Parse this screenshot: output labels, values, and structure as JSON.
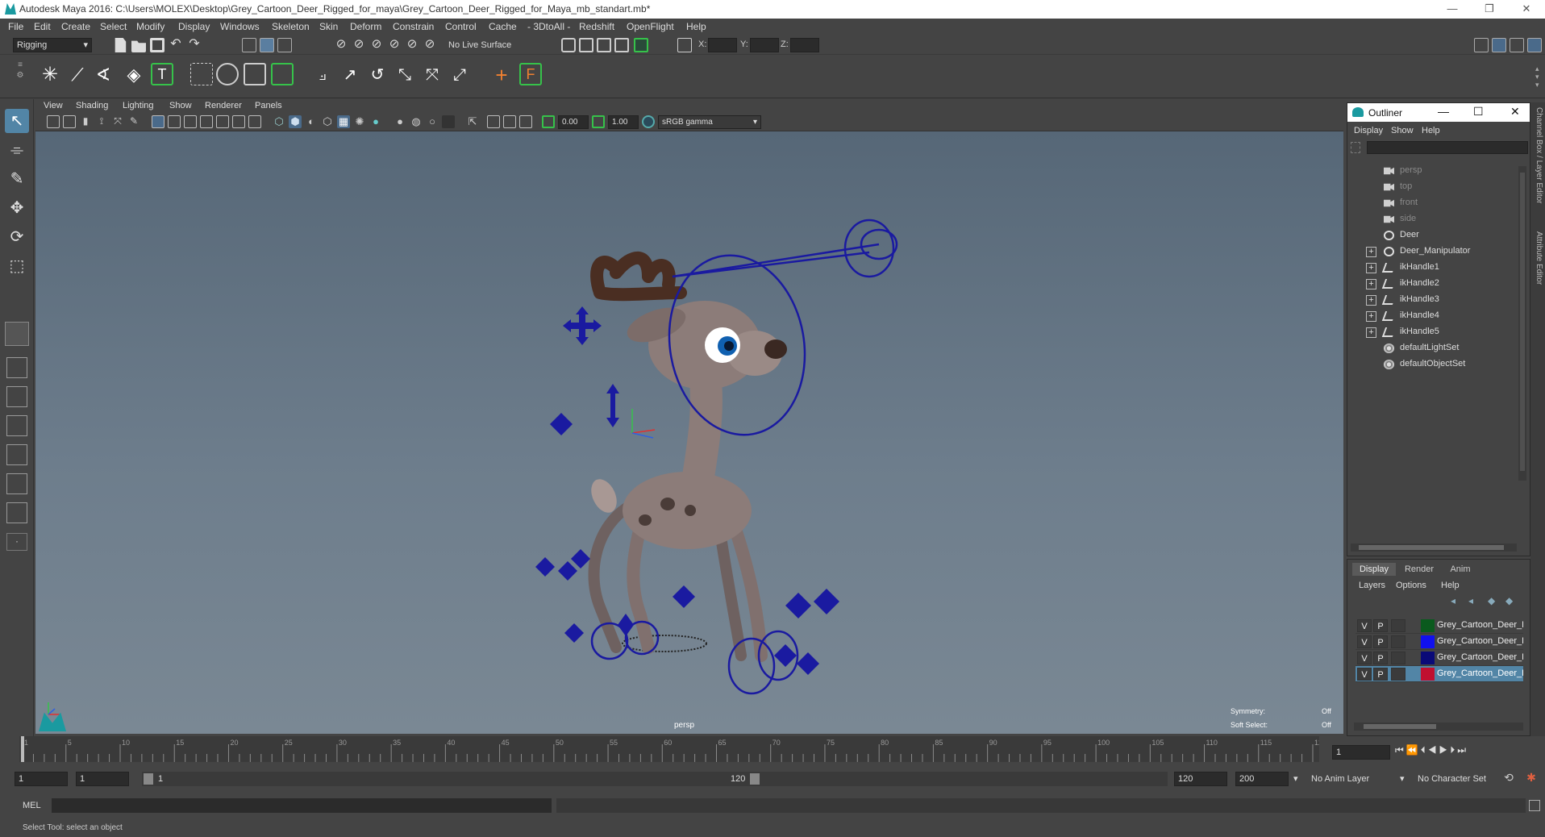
{
  "window": {
    "title": "Autodesk Maya 2016: C:\\Users\\MOLEX\\Desktop\\Grey_Cartoon_Deer_Rigged_for_maya\\Grey_Cartoon_Deer_Rigged_for_Maya_mb_standart.mb*",
    "minimize": "—",
    "restore": "❐",
    "close": "✕"
  },
  "menubar": [
    "File",
    "Edit",
    "Create",
    "Select",
    "Modify",
    "Display",
    "Windows",
    "Skeleton",
    "Skin",
    "Deform",
    "Constrain",
    "Control",
    "Cache",
    "- 3DtoAll -",
    "Redshift",
    "OpenFlight",
    "Help"
  ],
  "statusline": {
    "menuset": "Rigging",
    "live_surface": "No Live Surface",
    "x_label": "X:",
    "y_label": "Y:",
    "z_label": "Z:"
  },
  "viewport": {
    "menus": [
      "View",
      "Shading",
      "Lighting",
      "Show",
      "Renderer",
      "Panels"
    ],
    "exposure": "0.00",
    "gamma": "1.00",
    "color_space": "sRGB gamma",
    "camera_label": "persp",
    "symmetry_label": "Symmetry:",
    "symmetry_value": "Off",
    "soft_select_label": "Soft Select:",
    "soft_select_value": "Off"
  },
  "outliner": {
    "title": "Outliner",
    "menus": [
      "Display",
      "Show",
      "Help"
    ],
    "items": [
      {
        "label": "persp",
        "icon": "camera-icon",
        "expandable": false,
        "dim": true
      },
      {
        "label": "top",
        "icon": "camera-icon",
        "expandable": false,
        "dim": true
      },
      {
        "label": "front",
        "icon": "camera-icon",
        "expandable": false,
        "dim": true
      },
      {
        "label": "side",
        "icon": "camera-icon",
        "expandable": false,
        "dim": true
      },
      {
        "label": "Deer",
        "icon": "transform-icon",
        "expandable": false,
        "dim": false
      },
      {
        "label": "Deer_Manipulator",
        "icon": "transform-icon",
        "expandable": true,
        "dim": false
      },
      {
        "label": "ikHandle1",
        "icon": "ik-handle-icon",
        "expandable": true,
        "dim": false
      },
      {
        "label": "ikHandle2",
        "icon": "ik-handle-icon",
        "expandable": true,
        "dim": false
      },
      {
        "label": "ikHandle3",
        "icon": "ik-handle-icon",
        "expandable": true,
        "dim": false
      },
      {
        "label": "ikHandle4",
        "icon": "ik-handle-icon",
        "expandable": true,
        "dim": false
      },
      {
        "label": "ikHandle5",
        "icon": "ik-handle-icon",
        "expandable": true,
        "dim": false
      },
      {
        "label": "defaultLightSet",
        "icon": "set-icon",
        "expandable": false,
        "dim": false
      },
      {
        "label": "defaultObjectSet",
        "icon": "set-icon",
        "expandable": false,
        "dim": false
      }
    ]
  },
  "layer_editor": {
    "tabs": [
      "Display",
      "Render",
      "Anim"
    ],
    "menus": [
      "Layers",
      "Options",
      "Help"
    ],
    "layers": [
      {
        "v": "V",
        "p": "P",
        "color": "#0a5a1e",
        "name": "Grey_Cartoon_Deer_Rig",
        "selected": false
      },
      {
        "v": "V",
        "p": "P",
        "color": "#1010ee",
        "name": "Grey_Cartoon_Deer_Rig",
        "selected": false
      },
      {
        "v": "V",
        "p": "P",
        "color": "#0a0a78",
        "name": "Grey_Cartoon_Deer_Rig",
        "selected": false
      },
      {
        "v": "V",
        "p": "P",
        "color": "#c01030",
        "name": "Grey_Cartoon_Deer_Rig",
        "selected": true
      }
    ]
  },
  "side_tabs": {
    "channel_box": "Channel Box / Layer Editor",
    "attribute_editor": "Attribute Editor"
  },
  "timeline": {
    "ticks": [
      "1",
      "5",
      "10",
      "15",
      "20",
      "25",
      "30",
      "35",
      "40",
      "45",
      "50",
      "55",
      "60",
      "65",
      "70",
      "75",
      "80",
      "85",
      "90",
      "95",
      "100",
      "105",
      "110",
      "115",
      "120"
    ],
    "current_frame": "1"
  },
  "range": {
    "start": "1",
    "playback_start": "1",
    "slider_start": "1",
    "slider_end": "120",
    "playback_end": "120",
    "end": "200",
    "anim_layer": "No Anim Layer",
    "character_set": "No Character Set"
  },
  "cmdline": {
    "label": "MEL"
  },
  "helpline": {
    "text": "Select Tool: select an object"
  },
  "colors": {
    "accent_green": "#36c24a",
    "rig_blue": "#1a1aa0",
    "selection_blue": "#5285a6"
  }
}
